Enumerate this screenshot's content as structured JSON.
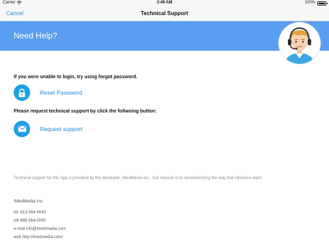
{
  "status_bar": {
    "carrier": "Carrier",
    "time": "3:49 AM",
    "battery_percent": "100%",
    "battery_level": 1.0,
    "wifi_icon": "wifi-icon"
  },
  "nav": {
    "cancel_label": "Cancel",
    "title": "Technical Support"
  },
  "banner": {
    "title": "Need Help?",
    "color": "#5a9ef0",
    "avatar_icon": "support-agent-avatar"
  },
  "main": {
    "login_hint": "If you were unable to login, try using forgot password.",
    "reset_password_label": "Reset Password",
    "reset_icon": "lock-icon",
    "support_hint": "Please request technical support by click the follwoing button:",
    "request_support_label": "Request support",
    "request_icon": "envelope-icon",
    "accent_color": "#1fa0e4"
  },
  "footer": {
    "disclaimer": "Technical support for this App is provided by the developer, iMedMedia Inc.. Our mission is to revolutionizing the way that clinicians learn.",
    "company": "iMedMedia Inc.",
    "tel": "tel. 613-564-0040",
    "toll": "toll 888-564-0040",
    "email": "e-mail info@imedmedia.com",
    "web": "web http://imedmedia.com/"
  }
}
